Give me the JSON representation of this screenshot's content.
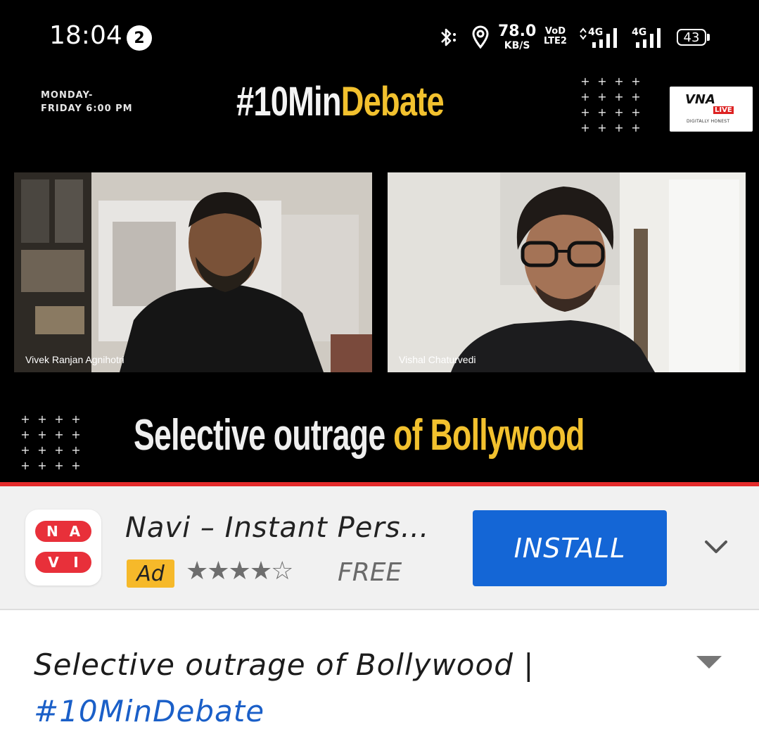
{
  "status_bar": {
    "time": "18:04",
    "notification_count": "2",
    "net_speed_value": "78.0",
    "net_speed_unit": "KB/S",
    "volte_top": "VoD",
    "volte_bottom": "LTE2",
    "sim1_label": "4G",
    "sim2_label": "4G",
    "battery": "43"
  },
  "video": {
    "schedule_line1": "MONDAY-",
    "schedule_line2": "FRIDAY 6:00 PM",
    "headline_white": "#10Min",
    "headline_yellow": "Debate",
    "channel_logo_text": "VNA",
    "channel_logo_live": "LIVE",
    "channel_logo_tag": "DIGITALLY HONEST",
    "left_speaker": "Vivek Ranjan Agnihotri",
    "right_speaker": "Vishal Chaturvedi",
    "topic_white": "Selective outrage ",
    "topic_yellow": "of Bollywood",
    "accent_yellow": "#f2c12e",
    "progress_color": "#e52b2b"
  },
  "ad": {
    "app_icon_top": [
      "N",
      "A"
    ],
    "app_icon_bottom": [
      "V",
      "I"
    ],
    "app_name": "Navi – Instant Pers…",
    "badge": "Ad",
    "stars": "★★★★☆",
    "rating": 4,
    "price": "FREE",
    "install_label": "INSTALL",
    "install_color": "#1466d6"
  },
  "video_info": {
    "title": "Selective outrage of Bollywood |",
    "hashtag": "#10MinDebate"
  }
}
